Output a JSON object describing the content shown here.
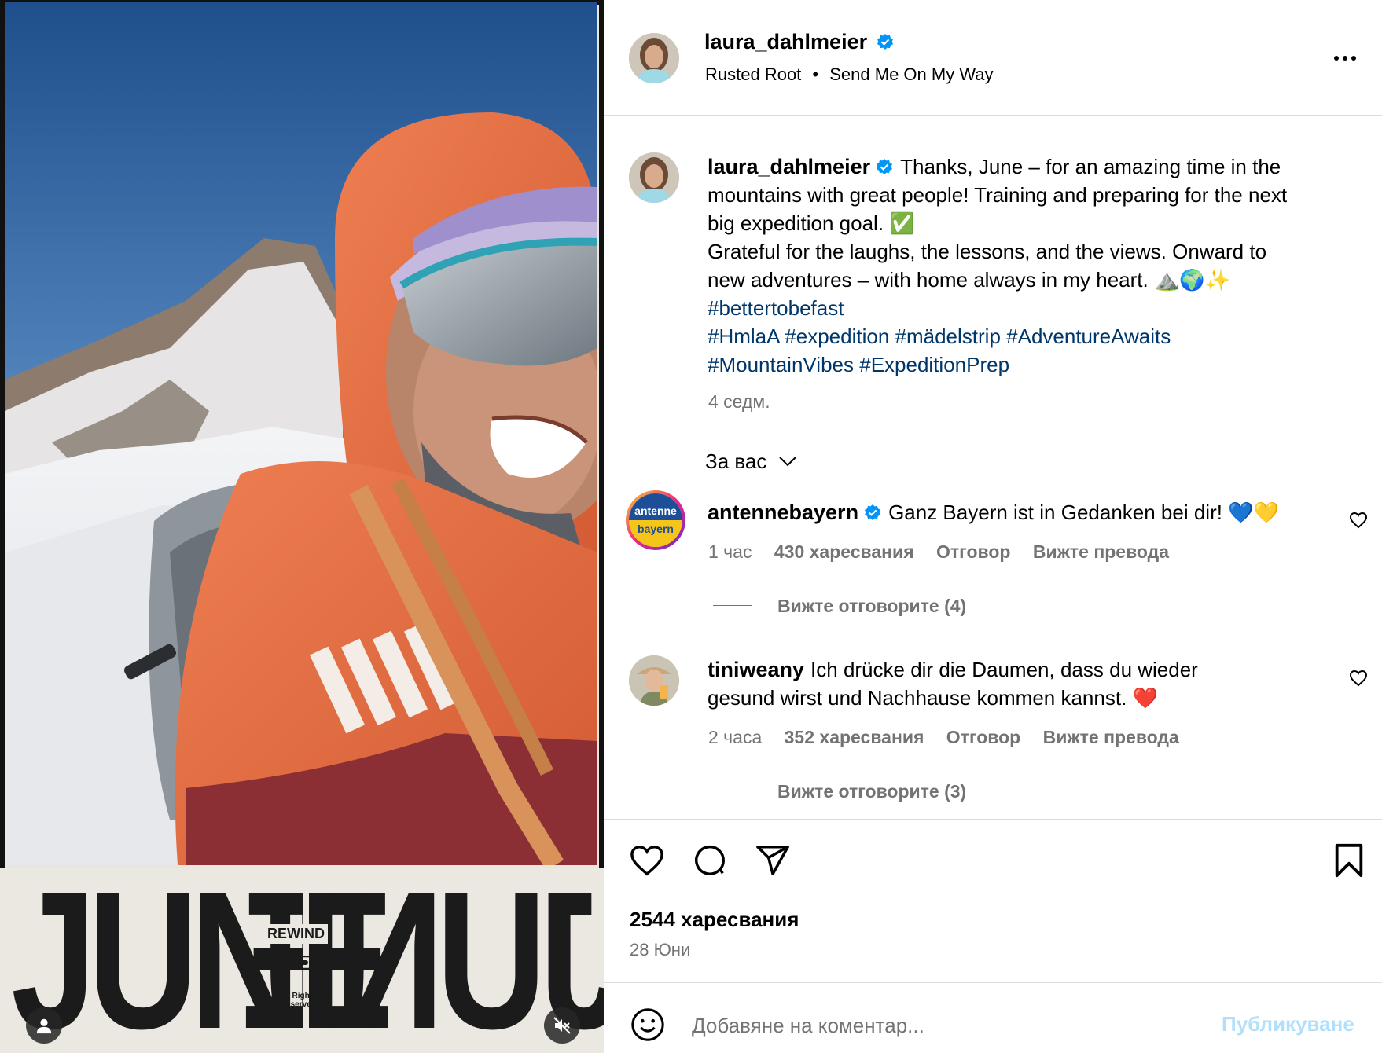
{
  "post": {
    "username": "laura_dahlmeier",
    "audio_artist": "Rusted Root",
    "audio_sep": "•",
    "audio_title": "Send Me On My Way",
    "caption_line1": "Thanks, June – for an amazing time in the",
    "caption_line2": "mountains with great people! Training and preparing for the next",
    "caption_line3": "big expedition goal. ✅",
    "caption_line4": "Grateful for the laughs, the lessons, and the views. Onward to",
    "caption_line5": "new adventures – with home always in my heart. ⛰️🌍✨",
    "hashtag_line1": [
      "#bettertobefast"
    ],
    "hashtag_line2": [
      "#HmlaA",
      "#expedition",
      "#mädelstrip",
      "#AdventureAwaits"
    ],
    "hashtag_line3": [
      "#MountainVibes",
      "#ExpeditionPrep"
    ],
    "caption_time": "4 седм.",
    "filter_label": "За вас"
  },
  "media_text": {
    "big_word_left": "JUNE",
    "big_word_right": "JUNE",
    "rewind": "REWIND",
    "rights_line1": "All Rights",
    "rights_line2": "Reserved"
  },
  "comments": [
    {
      "user": "antennebayern",
      "verified": true,
      "avatar_line1": "antenne",
      "avatar_line2": "bayern",
      "text": "Ganz Bayern ist in Gedanken bei dir! 💙💛",
      "time": "1 час",
      "likes": "430 харесвания",
      "reply": "Отговор",
      "translate": "Вижте превода",
      "view_replies": "Вижте отговорите (4)"
    },
    {
      "user": "tiniweany",
      "verified": false,
      "text_line1": "Ich drücke dir die Daumen, dass du wieder",
      "text_line2": "gesund wirst und Nachhause kommen kannst. ❤️",
      "time": "2 часа",
      "likes": "352 харесвания",
      "reply": "Отговор",
      "translate": "Вижте превода",
      "view_replies": "Вижте отговорите (3)"
    }
  ],
  "footer": {
    "likes": "2544 харесвания",
    "date": "28 Юни",
    "comment_placeholder": "Добавяне на коментар...",
    "publish": "Публикуване"
  },
  "colors": {
    "link": "#00376b",
    "verified": "#0095f6",
    "publish": "#b2dffc",
    "secondary_text": "#737373",
    "heart_red": "#ed4956"
  },
  "icons": [
    "more-icon",
    "heart-icon",
    "comment-icon",
    "share-icon",
    "bookmark-icon",
    "emoji-icon",
    "user-tag-icon",
    "mute-icon",
    "chevron-down-icon",
    "verified-badge-icon"
  ]
}
